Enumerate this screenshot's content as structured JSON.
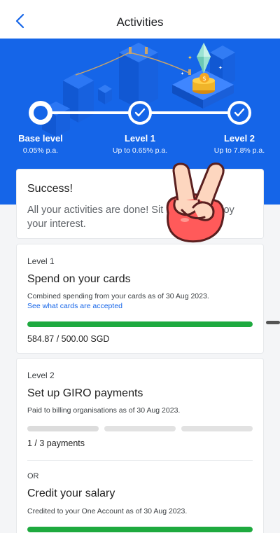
{
  "header": {
    "title": "Activities",
    "back_icon": "chevron-left-icon"
  },
  "colors": {
    "brand_blue": "#1565e8",
    "progress_green": "#1eaa3f",
    "track_grey": "#dedede"
  },
  "levels": [
    {
      "name": "Base level",
      "rate": "0.05% p.a.",
      "state": "current"
    },
    {
      "name": "Level 1",
      "rate": "Up to 0.65% p.a.",
      "state": "done"
    },
    {
      "name": "Level 2",
      "rate": "Up to 7.8% p.a.",
      "state": "done"
    }
  ],
  "success": {
    "title": "Success!",
    "message": "All your activities are done! Sit back and enjoy your interest."
  },
  "level1_card": {
    "level_label": "Level 1",
    "heading": "Spend on your cards",
    "subtext": "Combined spending from your cards as of 30 Aug 2023.",
    "link": "See what cards are accepted",
    "progress_fraction": 1.0,
    "amount_text": "584.87 / 500.00 SGD"
  },
  "level2_card": {
    "level_label": "Level 2",
    "heading": "Set up GIRO payments",
    "subtext": "Paid to billing organisations as of 30 Aug 2023.",
    "segments_completed": 1,
    "segments_total": 3,
    "count_text": "1 / 3 payments",
    "or_label": "OR",
    "alt_heading": "Credit your salary",
    "alt_subtext": "Credited to your One Account as of 30 Aug 2023.",
    "alt_progress_fraction": 1.0
  },
  "sticker": {
    "icon": "victory-hand-icon"
  }
}
